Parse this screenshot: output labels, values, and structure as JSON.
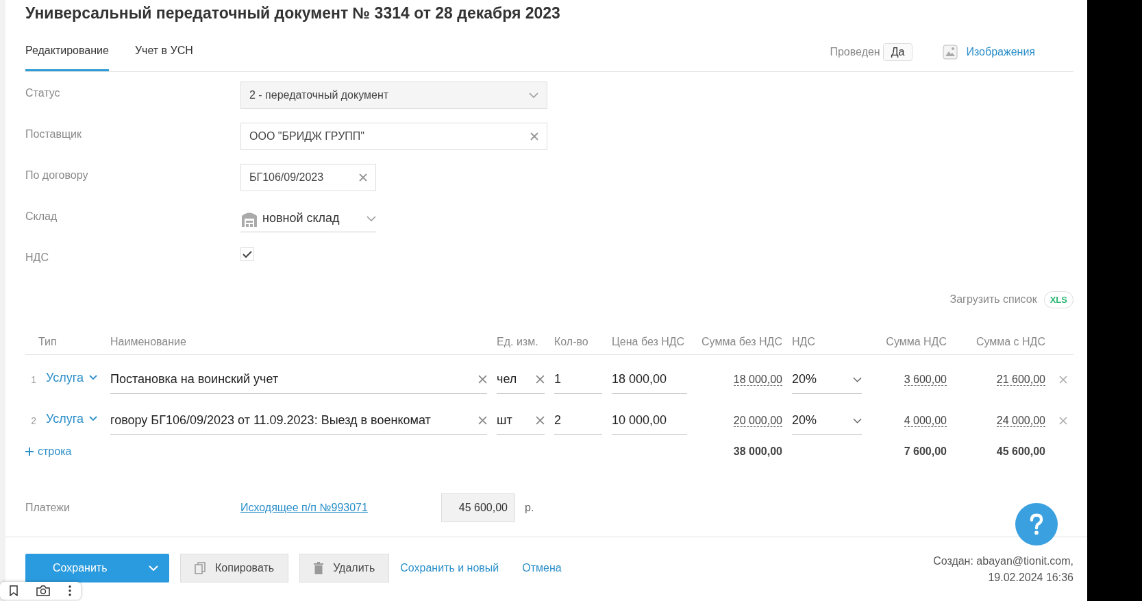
{
  "title": "Универсальный передаточный документ № 3314 от 28 декабря 2023",
  "tabs": [
    {
      "label": "Редактирование",
      "selected": true
    },
    {
      "label": "Учет в УСН",
      "selected": false
    }
  ],
  "posted": {
    "label": "Проведен",
    "value": "Да"
  },
  "images_link": "Изображения",
  "form": {
    "status": {
      "label": "Статус",
      "value": "2 - передаточный документ"
    },
    "supplier": {
      "label": "Поставщик",
      "value": "ООО \"БРИДЖ ГРУПП\""
    },
    "contract": {
      "label": "По договору",
      "value": "БГ106/09/2023"
    },
    "warehouse": {
      "label": "Склад",
      "value": "новной склад"
    },
    "vat": {
      "label": "НДС",
      "checked": true
    }
  },
  "upload": {
    "label": "Загрузить список",
    "badge": "XLS"
  },
  "table": {
    "columns": [
      "Тип",
      "Наименование",
      "Ед. изм.",
      "Кол-во",
      "Цена без НДС",
      "Сумма без НДС",
      "НДС",
      "Сумма НДС",
      "Сумма с НДС"
    ],
    "rows": [
      {
        "number": "1",
        "type": "Услуга",
        "name": "Постановка на воинский учет",
        "unit": "чел",
        "qty": "1",
        "price": "18 000,00",
        "sum": "18 000,00",
        "vat": "20%",
        "vat_sum": "3 600,00",
        "total": "21 600,00"
      },
      {
        "number": "2",
        "type": "Услуга",
        "name": "говору БГ106/09/2023 от 11.09.2023: Выезд в военкомат",
        "unit": "шт",
        "qty": "2",
        "price": "10 000,00",
        "sum": "20 000,00",
        "vat": "20%",
        "vat_sum": "4 000,00",
        "total": "24 000,00"
      }
    ],
    "add_row": "строка",
    "totals": {
      "sum": "38 000,00",
      "vat_sum": "7 600,00",
      "total": "45 600,00"
    }
  },
  "payments": {
    "label": "Платежи",
    "link": "Исходящее п/п №993071",
    "amount": "45 600,00",
    "currency": "р."
  },
  "buttons": {
    "save": "Сохранить",
    "copy": "Копировать",
    "delete": "Удалить",
    "save_new": "Сохранить и новый",
    "cancel": "Отмена"
  },
  "created": {
    "by": "Создан: abayan@tionit.com,",
    "date": "19.02.2024 16:36"
  }
}
